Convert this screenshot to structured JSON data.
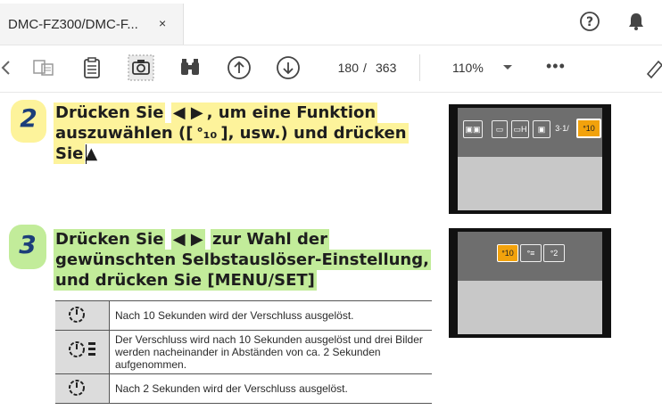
{
  "tab": {
    "title": "DMC-FZ300/DMC-F...",
    "close": "×"
  },
  "toolbar": {
    "page_current": "180",
    "page_sep": "/",
    "page_total": "363",
    "zoom": "110%",
    "more": "•••"
  },
  "step2": {
    "number": "2",
    "l1a": "Drücken Sie",
    "l1b": "◀ ▶",
    "l1c": ", um eine Funktion",
    "l2a": "auszuwählen ([",
    "l2b": "ᐤ₁₀",
    "l2c": "], usw.) und drücken",
    "l3a": "Sie",
    "l3b": "▲"
  },
  "step3": {
    "number": "3",
    "l1a": "Drücken Sie",
    "l1b": "◀ ▶",
    "l1c": "zur Wahl der",
    "l2": "gewünschten Selbstauslöser-Einstellung,",
    "l3": "und drücken Sie [MENU/SET]"
  },
  "table": [
    {
      "icon": "ᐤ10",
      "text": "Nach 10 Sekunden wird der Verschluss ausgelöst."
    },
    {
      "icon": "ᐤ10≡",
      "text": "Der Verschluss wird nach 10 Sekunden ausgelöst und drei Bilder werden nacheinander in Abständen von ca. 2 Sekunden aufgenommen."
    },
    {
      "icon": "ᐤ2",
      "text": "Nach 2 Sekunden wird der Verschluss ausgelöst."
    }
  ],
  "screen1": {
    "items": [
      "▣▣",
      "▭",
      "▭H",
      "▣",
      "3·1/",
      "ᐤ10"
    ]
  },
  "screen2": {
    "items": [
      "ᐤ10",
      "ᐤ≡",
      "ᐤ2"
    ]
  },
  "colors": {
    "yellow_highlight": "#fdf39b",
    "green_highlight": "#c2ec9a",
    "accent_orange": "#f2a20c",
    "step_number": "#1c3e7a"
  }
}
